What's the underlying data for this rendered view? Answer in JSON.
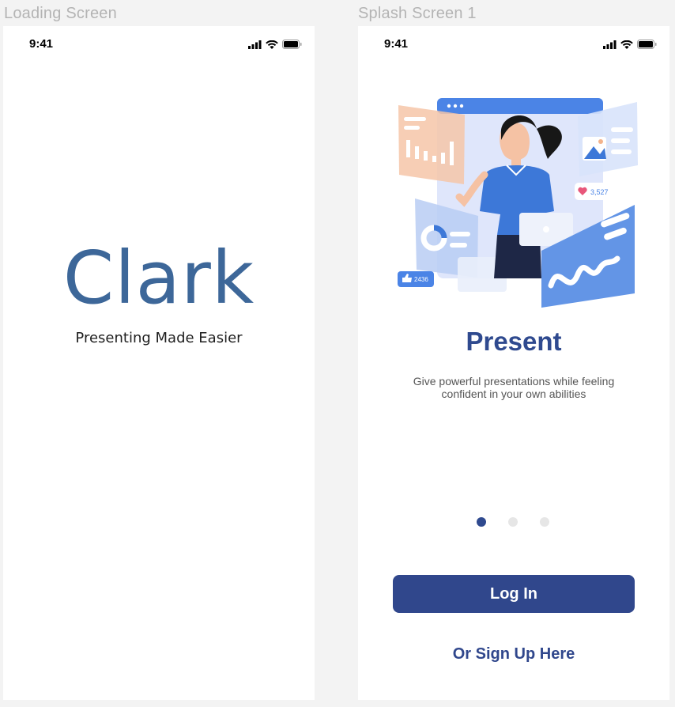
{
  "frames": {
    "loading": {
      "label": "Loading Screen",
      "status_time": "9:41",
      "brand_title": "Clark",
      "tagline": "Presenting Made Easier"
    },
    "splash": {
      "label": "Splash Screen 1",
      "status_time": "9:41",
      "title": "Present",
      "description": "Give powerful presentations while feeling confident in your own abilities",
      "illustration": {
        "likes_count": "3,527",
        "thumbs_count": "2436"
      },
      "pagination": {
        "total": 3,
        "active_index": 0
      },
      "login_label": "Log In",
      "signup_label": "Or Sign Up Here"
    }
  },
  "colors": {
    "brand": "#3d6799",
    "primary": "#30478c",
    "title": "#2f4a8f",
    "background": "#f3f3f3"
  },
  "icons": [
    "signal-icon",
    "wifi-icon",
    "battery-icon",
    "heart-icon",
    "thumbs-up-icon"
  ]
}
